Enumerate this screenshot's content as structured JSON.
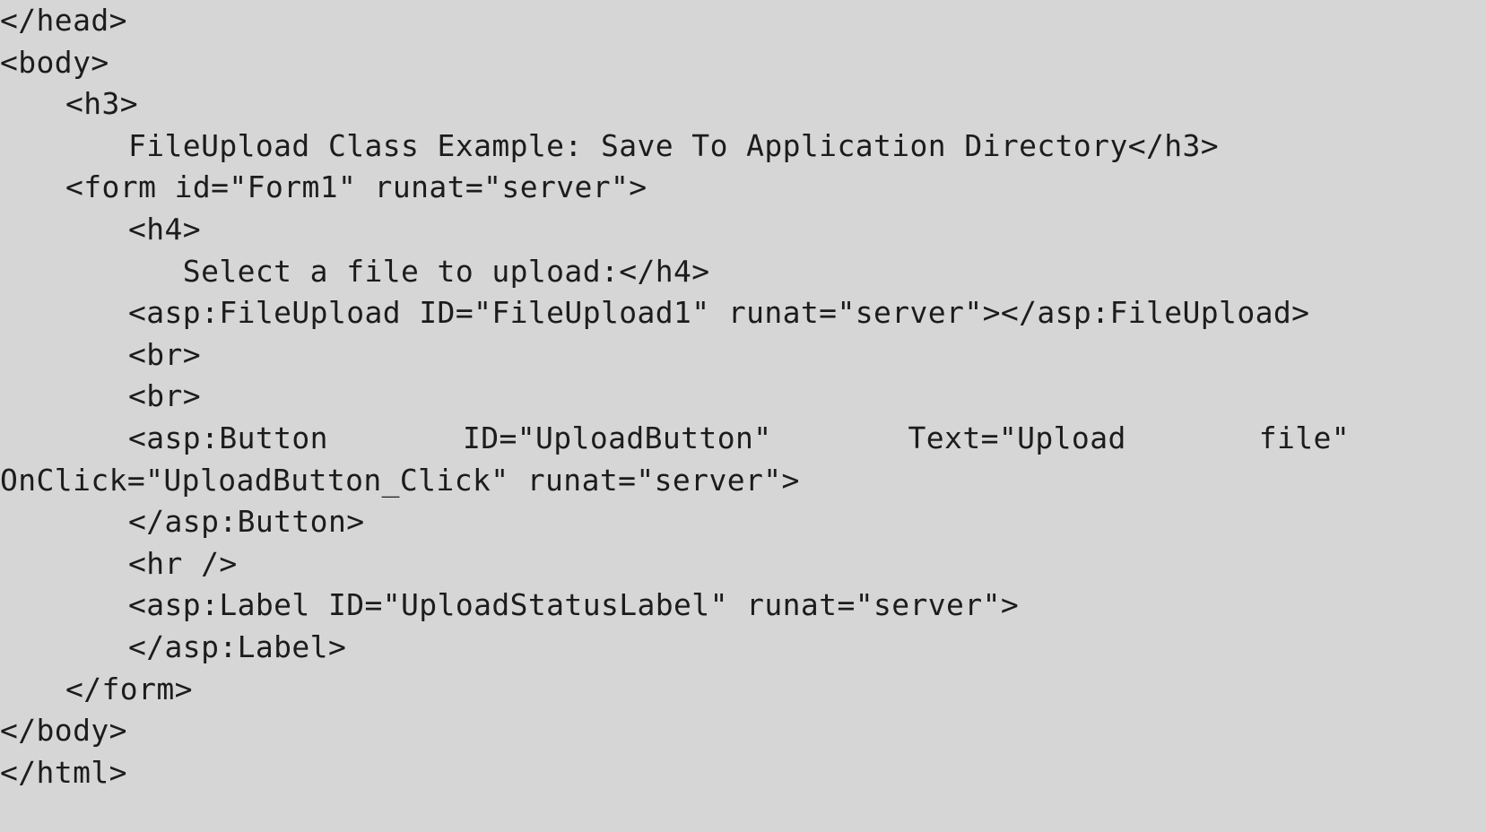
{
  "document": {
    "kind": "source-code-listing",
    "language": "ASP.NET (aspx markup)",
    "background_color": "#d6d6d6",
    "text_color": "#1c1c1c",
    "lines": [
      {
        "id": "line-1",
        "indent": 0,
        "text": "</head>"
      },
      {
        "id": "line-2",
        "indent": 0,
        "text": "<body>"
      },
      {
        "id": "line-3",
        "indent": 1,
        "text": "<h3>"
      },
      {
        "id": "line-4",
        "indent": 2,
        "text": "FileUpload Class Example: Save To Application Directory</h3>"
      },
      {
        "id": "line-5",
        "indent": 1,
        "text": "<form id=\"Form1\" runat=\"server\">"
      },
      {
        "id": "line-6",
        "indent": 2,
        "text": "<h4>"
      },
      {
        "id": "line-7",
        "indent": 2,
        "text": "   Select a file to upload:</h4>"
      },
      {
        "id": "line-8",
        "indent": 2,
        "text": "<asp:FileUpload ID=\"FileUpload1\" runat=\"server\"></asp:FileUpload>"
      },
      {
        "id": "line-9",
        "indent": 2,
        "text": "<br>"
      },
      {
        "id": "line-10",
        "indent": 2,
        "text": "<br>"
      },
      {
        "id": "line-11",
        "indent": 2,
        "justified": true,
        "segments": [
          "<asp:Button",
          "ID=\"UploadButton\"",
          "Text=\"Upload",
          "file\""
        ]
      },
      {
        "id": "line-12",
        "indent": 0,
        "text": "OnClick=\"UploadButton_Click\" runat=\"server\">"
      },
      {
        "id": "line-13",
        "indent": 2,
        "text": "</asp:Button>"
      },
      {
        "id": "line-14",
        "indent": 2,
        "text": "<hr />"
      },
      {
        "id": "line-15",
        "indent": 2,
        "text": "<asp:Label ID=\"UploadStatusLabel\" runat=\"server\">"
      },
      {
        "id": "line-16",
        "indent": 2,
        "text": "</asp:Label>"
      },
      {
        "id": "line-17",
        "indent": 1,
        "text": "</form>"
      },
      {
        "id": "line-18",
        "indent": 0,
        "text": "</body>"
      },
      {
        "id": "line-19",
        "indent": 0,
        "text": "</html>"
      }
    ]
  }
}
